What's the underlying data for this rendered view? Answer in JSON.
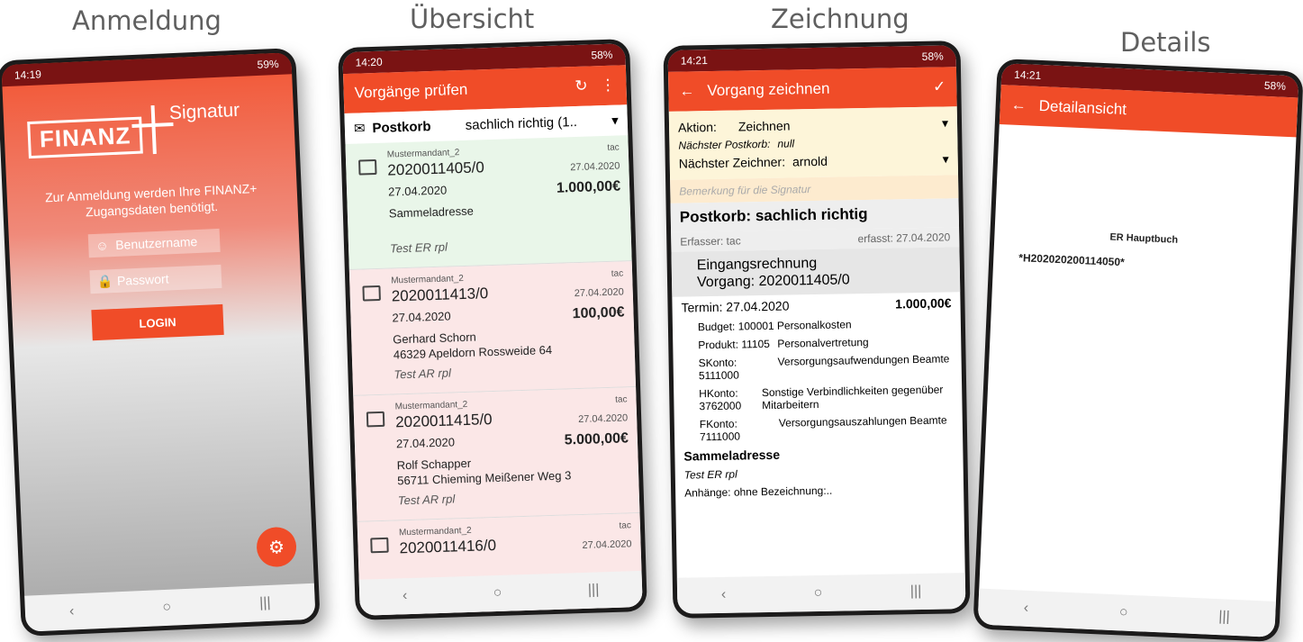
{
  "captions": {
    "login": "Anmeldung",
    "overview": "Übersicht",
    "sign": "Zeichnung",
    "details": "Details"
  },
  "login": {
    "time": "14:19",
    "battery": "59%",
    "logo_left": "FINANZ",
    "logo_right": "Signatur",
    "info": "Zur Anmeldung werden Ihre FINANZ+ Zugangsdaten benötigt.",
    "username_placeholder": "Benutzername",
    "password_placeholder": "Passwort",
    "button": "LOGIN"
  },
  "overview": {
    "time": "14:20",
    "battery": "58%",
    "title": "Vorgänge prüfen",
    "postkorb_label": "Postkorb",
    "filter": "sachlich richtig (1..",
    "items": [
      {
        "mandant": "Mustermandant_2",
        "user": "tac",
        "nr": "2020011405/0",
        "created": "27.04.2020",
        "date": "27.04.2020",
        "amount": "1.000,00€",
        "addr1": "Sammeladresse",
        "addr2": "",
        "type": "Test ER rpl",
        "bg": "#e9f6e9"
      },
      {
        "mandant": "Mustermandant_2",
        "user": "tac",
        "nr": "2020011413/0",
        "created": "27.04.2020",
        "date": "27.04.2020",
        "amount": "100,00€",
        "addr1": "Gerhard Schorn",
        "addr2": "46329 Apeldorn Rossweide 64",
        "type": "Test AR rpl",
        "bg": "#fbe7e7"
      },
      {
        "mandant": "Mustermandant_2",
        "user": "tac",
        "nr": "2020011415/0",
        "created": "27.04.2020",
        "date": "27.04.2020",
        "amount": "5.000,00€",
        "addr1": "Rolf Schapper",
        "addr2": "56711 Chieming Meißener Weg 3",
        "type": "Test AR rpl",
        "bg": "#fbe7e7"
      },
      {
        "mandant": "Mustermandant_2",
        "user": "tac",
        "nr": "2020011416/0",
        "created": "27.04.2020",
        "date": "",
        "amount": "",
        "addr1": "",
        "addr2": "",
        "type": "",
        "bg": "#fbe7e7"
      }
    ]
  },
  "sign": {
    "time": "14:21",
    "battery": "58%",
    "title": "Vorgang zeichnen",
    "action_label": "Aktion:",
    "action_value": "Zeichnen",
    "next_box_label": "Nächster Postkorb:",
    "next_box_value": "null",
    "next_signer_label": "Nächster Zeichner:",
    "next_signer_value": "arnold",
    "remark_placeholder": "Bemerkung für die Signatur",
    "postkorb": "Postkorb: sachlich richtig",
    "erfasser": "Erfasser: tac",
    "erfasst": "erfasst: 27.04.2020",
    "doc_type": "Eingangsrechnung",
    "vorgang": "Vorgang: 2020011405/0",
    "termin": "Termin: 27.04.2020",
    "amount": "1.000,00€",
    "budget": "Budget: 100001",
    "budget_desc": "Personalkosten",
    "produkt": "Produkt: 11105",
    "produkt_desc": "Personalvertretung",
    "skonto_label": "SKonto:",
    "skonto_value": "5111000",
    "skonto_desc": "Versorgungsaufwendungen Beamte",
    "hkonto_label": "HKonto:",
    "hkonto_value": "3762000",
    "hkonto_desc": "Sonstige Verbindlichkeiten gegenüber Mitarbeitern",
    "fkonto_label": "FKonto:",
    "fkonto_value": "7111000",
    "fkonto_desc": "Versorgungsauszahlungen Beamte",
    "address": "Sammeladresse",
    "type": "Test ER rpl",
    "attach_label": "Anhänge:",
    "attach_value": "ohne Bezeichnung:.."
  },
  "details": {
    "time": "14:21",
    "battery": "58%",
    "title": "Detailansicht",
    "doc_title": "ER Hauptbuch",
    "barcode": "*H202020200114050*"
  }
}
